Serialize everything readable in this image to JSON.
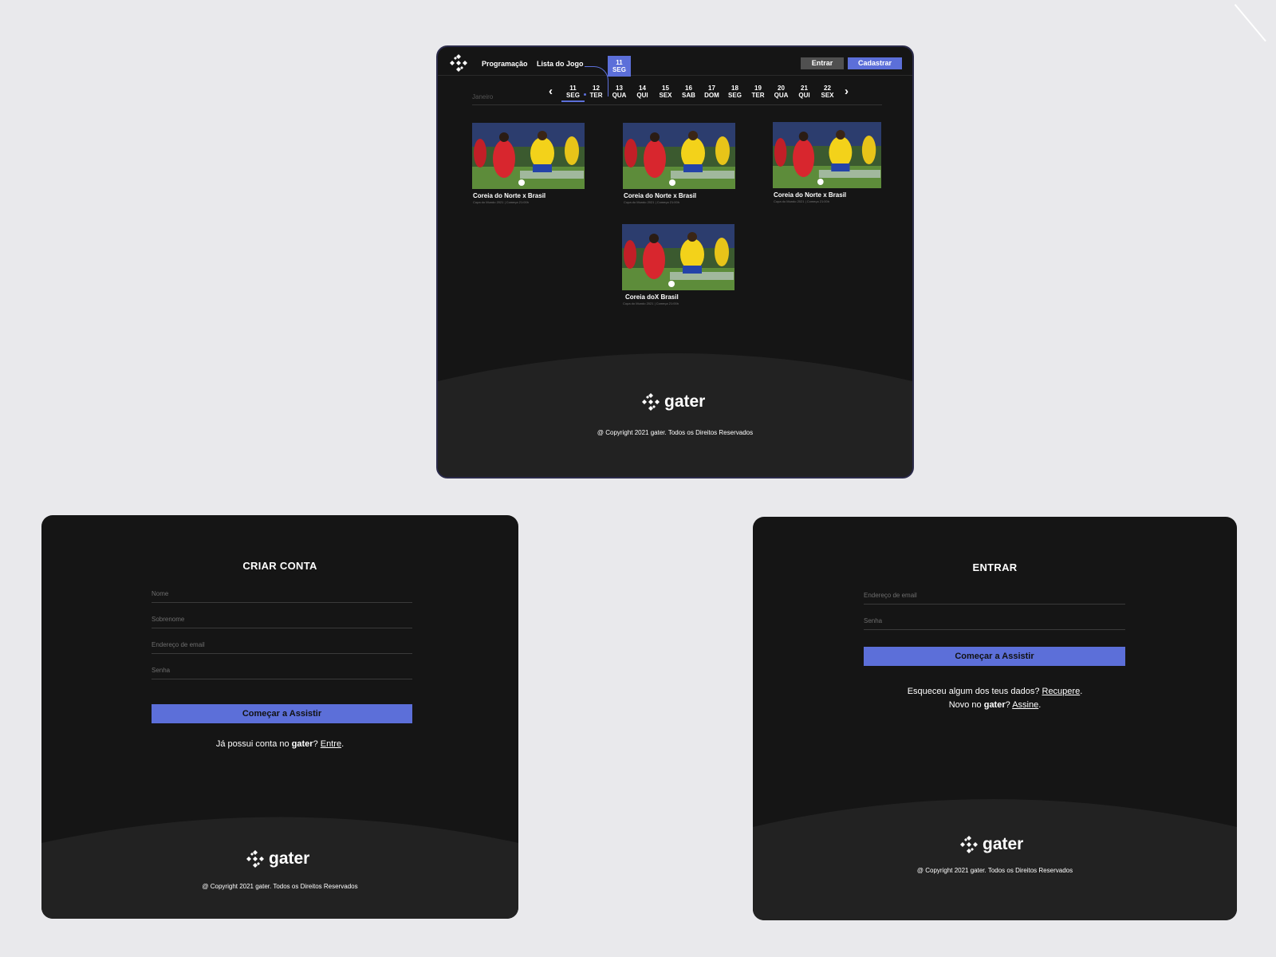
{
  "colors": {
    "accent": "#5c6fd9",
    "background": "#151515",
    "footer": "#222222",
    "canvas": "#e9e9ec"
  },
  "main": {
    "nav": {
      "programacao": "Programação",
      "lista": "Lista do Jogo"
    },
    "tooltip": {
      "day": "11",
      "weekday": "SEG"
    },
    "buttons": {
      "entrar": "Entrar",
      "cadastrar": "Cadastrar"
    },
    "month": "Janeiro",
    "prev_icon": "‹",
    "next_icon": "›",
    "days": [
      {
        "num": "11",
        "wd": "SEG",
        "active": true
      },
      {
        "num": "12",
        "wd": "TER"
      },
      {
        "num": "13",
        "wd": "QUA"
      },
      {
        "num": "14",
        "wd": "QUI"
      },
      {
        "num": "15",
        "wd": "SEX"
      },
      {
        "num": "16",
        "wd": "SAB"
      },
      {
        "num": "17",
        "wd": "DOM"
      },
      {
        "num": "18",
        "wd": "SEG"
      },
      {
        "num": "19",
        "wd": "TER"
      },
      {
        "num": "20",
        "wd": "QUA"
      },
      {
        "num": "21",
        "wd": "QUI"
      },
      {
        "num": "22",
        "wd": "SEX"
      }
    ],
    "cards": [
      {
        "title": "Coreia do Norte x Brasil",
        "sub": "Copa do Mundo 2021 | Começa 21:00h"
      },
      {
        "title": "Coreia do Norte x Brasil",
        "sub": "Copa do Mundo 2021 | Começa 21:00h"
      },
      {
        "title": "Coreia do Norte x Brasil",
        "sub": "Copa do Mundo 2021 | Começa 21:00h"
      },
      {
        "title": "Coreia doX Brasil",
        "sub": "Copa do Mundo 2021 | Começa 21:00h"
      }
    ],
    "brand": "gater",
    "copyright": "@ Copyright  2021 gater. Todos os Direitos Reservados"
  },
  "signup": {
    "title": "CRIAR CONTA",
    "fields": {
      "nome": "Nome",
      "sobrenome": "Sobrenome",
      "email": "Endereço de email",
      "senha": "Senha"
    },
    "cta": "Começar a Assistir",
    "helper_pre": "Já possui conta no ",
    "helper_brand": "gater",
    "helper_q": "? ",
    "helper_link": "Entre",
    "helper_end": ".",
    "brand": "gater",
    "copyright": "@ Copyright  2021 gater. Todos os Direitos Reservados"
  },
  "login": {
    "title": "ENTRAR",
    "fields": {
      "email": "Endereço de email",
      "senha": "Senha"
    },
    "cta": "Começar a Assistir",
    "forgot_pre": "Esqueceu algum dos teus dados? ",
    "forgot_link": "Recupere",
    "forgot_end": ".",
    "new_pre": "Novo no ",
    "new_brand": "gater",
    "new_q": "? ",
    "new_link": "Assine",
    "new_end": ".",
    "brand": "gater",
    "copyright": "@ Copyright  2021 gater. Todos os Direitos Reservados"
  }
}
